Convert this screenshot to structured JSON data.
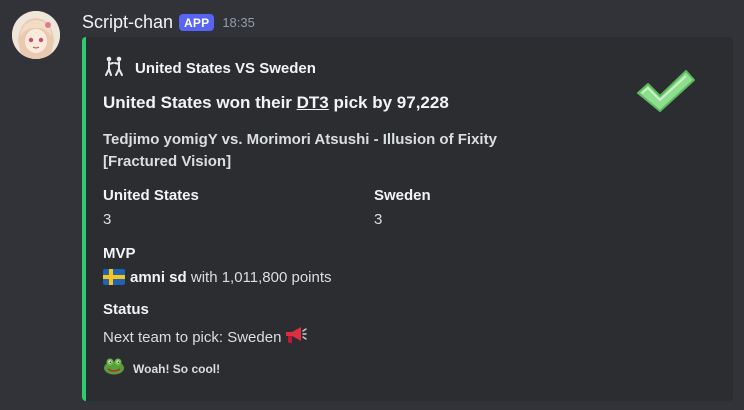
{
  "message": {
    "username": "Script-chan",
    "badge": "APP",
    "timestamp": "18:35",
    "avatar_icon": "anime-girl-avatar"
  },
  "embed": {
    "accent_color": "#2ecc71",
    "author": "United States VS Sweden",
    "author_icon": "fighting-people-icon",
    "title_prefix": "United States won their ",
    "title_link": "DT3",
    "title_suffix": " pick by 97,228",
    "description_line1": "Tedjimo yomigY vs. Morimori Atsushi - Illusion of Fixity",
    "description_line2": "[Fractured Vision]",
    "fields": {
      "team1_name": "United States",
      "team1_value": "3",
      "team2_name": "Sweden",
      "team2_value": "3",
      "mvp_name": "MVP",
      "mvp_player": "amni sd",
      "mvp_flag": "sweden-flag",
      "mvp_suffix": " with 1,011,800 points",
      "status_name": "Status",
      "status_value": "Next team to pick: Sweden"
    },
    "status_icon": "megaphone-icon",
    "thumbnail_icon": "green-checkmark-icon",
    "footer_text": "Woah! So cool!",
    "footer_icon": "frog-icon"
  }
}
